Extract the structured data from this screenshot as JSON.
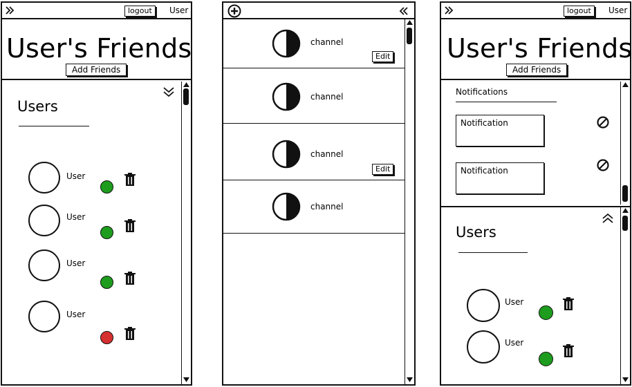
{
  "header": {
    "logout_label": "logout",
    "user_label": "User",
    "page_title": "User's Friends",
    "add_friends_label": "Add Friends"
  },
  "left_panel": {
    "section_title": "Users",
    "users": [
      {
        "name": "User",
        "status": "online"
      },
      {
        "name": "User",
        "status": "online"
      },
      {
        "name": "User",
        "status": "online"
      },
      {
        "name": "User",
        "status": "offline"
      }
    ]
  },
  "middle_panel": {
    "channels": [
      {
        "label": "channel",
        "edit_label": "Edit"
      },
      {
        "label": "channel",
        "edit_label": ""
      },
      {
        "label": "channel",
        "edit_label": "Edit"
      },
      {
        "label": "channel",
        "edit_label": ""
      }
    ]
  },
  "right_panel": {
    "notifications_title": "Notifications",
    "notifications": [
      {
        "text": "Notification"
      },
      {
        "text": "Notification"
      }
    ],
    "section_title": "Users",
    "users": [
      {
        "name": "User",
        "status": "online"
      },
      {
        "name": "User",
        "status": "online"
      }
    ]
  },
  "colors": {
    "online": "#1e9c1e",
    "offline": "#d63030",
    "border": "#111111"
  },
  "icons": {
    "expand": "double-chevron-right-icon",
    "collapse": "double-chevron-left-icon",
    "add": "circle-plus-icon",
    "trash": "trash-icon",
    "block": "block-icon",
    "channel": "half-circle-icon",
    "chevron_down": "double-chevron-down-icon",
    "chevron_up": "double-chevron-up-icon"
  }
}
